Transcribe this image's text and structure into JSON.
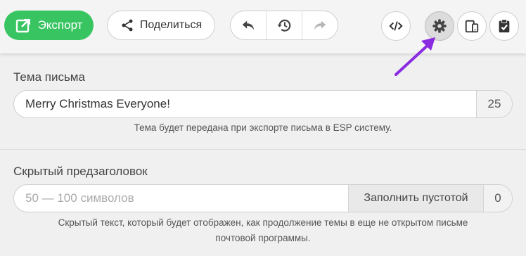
{
  "toolbar": {
    "export_label": "Экспорт",
    "share_label": "Поделиться",
    "icons": {
      "export": "export-icon",
      "share": "share-icon",
      "undo": "undo-icon",
      "history": "history-icon",
      "redo": "redo-icon",
      "code": "code-icon",
      "settings": "gear-icon",
      "devices": "devices-icon",
      "clipboard": "clipboard-check-icon"
    }
  },
  "colors": {
    "export_green": "#38c561",
    "arrow_purple": "#8a2be2"
  },
  "subject": {
    "label": "Тема письма",
    "value": "Merry Christmas Everyone!",
    "count": "25",
    "hint": "Тема будет передана при экспорте письма в ESP систему."
  },
  "preheader": {
    "label": "Скрытый предзаголовок",
    "placeholder": "50 — 100 символов",
    "fill_label": "Заполнить пустотой",
    "count": "0",
    "hint_line1": "Скрытый текст, который будет отображен, как продолжение темы в еще не открытом письме",
    "hint_line2": "почтовой программы."
  }
}
